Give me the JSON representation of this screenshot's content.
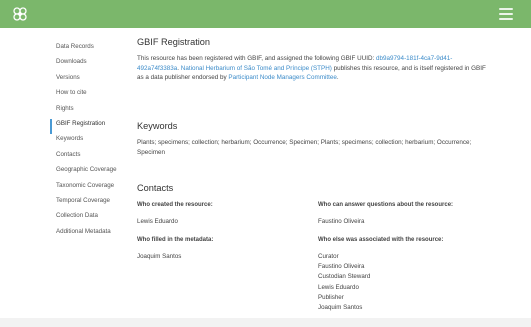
{
  "sidebar": {
    "items": [
      {
        "label": "Data Records"
      },
      {
        "label": "Downloads"
      },
      {
        "label": "Versions"
      },
      {
        "label": "How to cite"
      },
      {
        "label": "Rights"
      },
      {
        "label": "GBIF Registration"
      },
      {
        "label": "Keywords"
      },
      {
        "label": "Contacts"
      },
      {
        "label": "Geographic Coverage"
      },
      {
        "label": "Taxonomic Coverage"
      },
      {
        "label": "Temporal Coverage"
      },
      {
        "label": "Collection Data"
      },
      {
        "label": "Additional Metadata"
      }
    ],
    "active_index": 5
  },
  "gbif": {
    "title": "GBIF Registration",
    "text1": "This resource has been registered with GBIF, and assigned the following GBIF UUID: ",
    "uuid": "db9a9794-181f-4ca7-9d41-492a74f3383a",
    "text2": ". ",
    "publisher": "National Herbarium of São Tomé and Príncipe (STPH)",
    "text3": " publishes this resource, and is itself registered in GBIF as a data publisher endorsed by ",
    "endorser": "Participant Node Managers Committee",
    "text4": "."
  },
  "keywords": {
    "title": "Keywords",
    "text": "Plants; specimens; collection; herbarium; Occurrence; Specimen; Plants; specimens; collection; herbarium; Occurrence; Specimen"
  },
  "contacts": {
    "title": "Contacts",
    "created_label": "Who created the resource:",
    "created": [
      "Lewis Eduardo"
    ],
    "answer_label": "Who can answer questions about the resource:",
    "answer": [
      "Faustino Oliveira"
    ],
    "filled_label": "Who filled in the metadata:",
    "filled": [
      "Joaquim Santos"
    ],
    "associated_label": "Who else was associated with the resource:",
    "associated": [
      "Curator",
      "Faustino Oliveira",
      "Custodian Steward",
      "Lewis Eduardo",
      "Publisher",
      "Joaquim Santos"
    ]
  },
  "colors": {
    "topbar": "#7bb76b",
    "link": "#3b8bc9",
    "active_marker": "#4a9ad4"
  },
  "icons": {
    "logo": "gbif-logo-icon",
    "menu": "hamburger-menu-icon"
  }
}
